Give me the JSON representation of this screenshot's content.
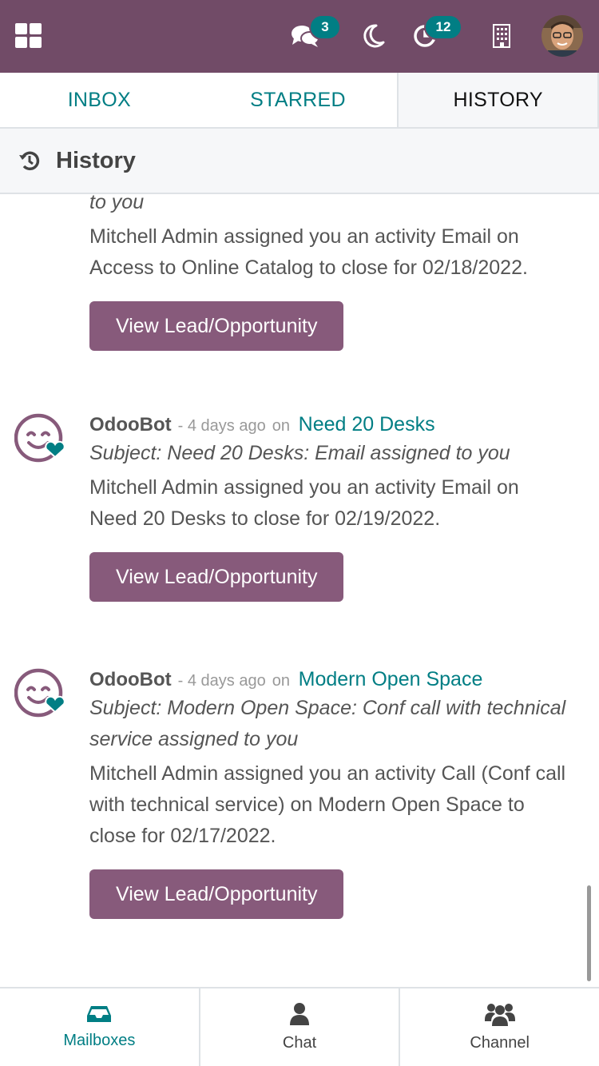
{
  "topbar": {
    "messages_badge": "3",
    "activities_badge": "12",
    "colors": {
      "bar": "#714b67",
      "badge": "#017e84"
    }
  },
  "tabs": [
    {
      "label": "INBOX",
      "active": false
    },
    {
      "label": "STARRED",
      "active": false
    },
    {
      "label": "HISTORY",
      "active": true
    }
  ],
  "section": {
    "title": "History"
  },
  "messages": [
    {
      "subject_tail": "to you",
      "text": "Mitchell Admin assigned you an activity Email on Access to Online Catalog to close for 02/18/2022.",
      "button": "View Lead/Opportunity"
    },
    {
      "author": "OdooBot",
      "date": "- 4 days ago",
      "on": "on",
      "record": "Need 20 Desks",
      "subject": "Subject: Need 20 Desks: Email assigned to you",
      "text": "Mitchell Admin assigned you an activity Email on Need 20 Desks to close for 02/19/2022.",
      "button": "View Lead/Opportunity"
    },
    {
      "author": "OdooBot",
      "date": "- 4 days ago",
      "on": "on",
      "record": "Modern Open Space",
      "subject": "Subject: Modern Open Space: Conf call with technical service assigned to you",
      "text": "Mitchell Admin assigned you an activity Call (Conf call with technical service) on Modern Open Space to close for 02/17/2022.",
      "button": "View Lead/Opportunity"
    }
  ],
  "bottom_nav": [
    {
      "label": "Mailboxes",
      "active": true
    },
    {
      "label": "Chat",
      "active": false
    },
    {
      "label": "Channel",
      "active": false
    }
  ]
}
